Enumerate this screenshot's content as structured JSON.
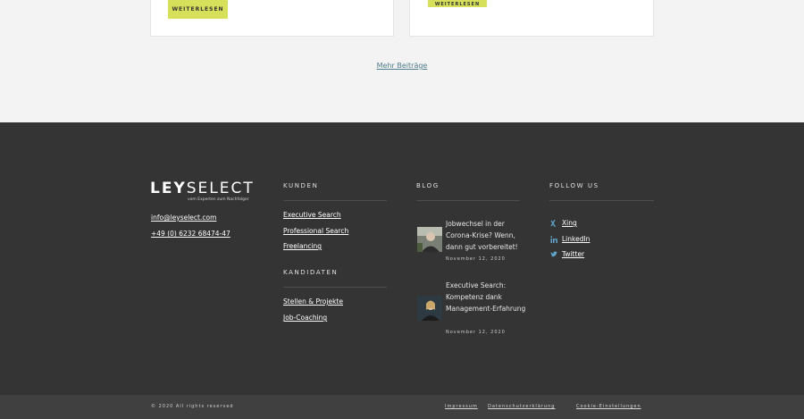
{
  "cards": {
    "left_button": "Weiterlesen",
    "right_button": "Weiterlesen"
  },
  "more_posts": "Mehr Beiträge",
  "footer": {
    "logo": {
      "bold": "LEY",
      "light": "SELECT",
      "tagline": "vom Experten zum Nachfolger"
    },
    "contact": {
      "email": "info@leyselect.com",
      "phone": "+49 (0) 6232 68474-47"
    },
    "kunden": {
      "heading": "Kunden",
      "links": [
        "Executive Search",
        "Professional Search",
        "Freelancing"
      ]
    },
    "kandidaten": {
      "heading": "Kandidaten",
      "links": [
        "Stellen & Projekte",
        "Job-Coaching"
      ]
    },
    "blog": {
      "heading": "Blog",
      "posts": [
        {
          "title": "Jobwechsel in der Corona-Krise? Wenn, dann gut vorbereitet!",
          "date": "November 12, 2020"
        },
        {
          "title": "Executive Search: Kompetenz dank Management-Erfahrung",
          "date": "November 12, 2020"
        }
      ]
    },
    "follow": {
      "heading": "Follow us",
      "items": [
        {
          "label": "Xing",
          "icon": "xing-icon"
        },
        {
          "label": "LinkedIn",
          "icon": "linkedin-icon"
        },
        {
          "label": "Twitter",
          "icon": "twitter-icon"
        }
      ]
    }
  },
  "bottom": {
    "copyright": "© 2020 All rights reserved",
    "links": [
      "Impressum",
      "Datenschutzerklärung",
      "Cookie-Einstellungen"
    ]
  },
  "colors": {
    "accent": "#d6e05a",
    "footer_bg": "#343434",
    "bottom_bg": "#404040",
    "link_blue": "#4d7c8c",
    "social_icon": "#5fa3c9"
  }
}
